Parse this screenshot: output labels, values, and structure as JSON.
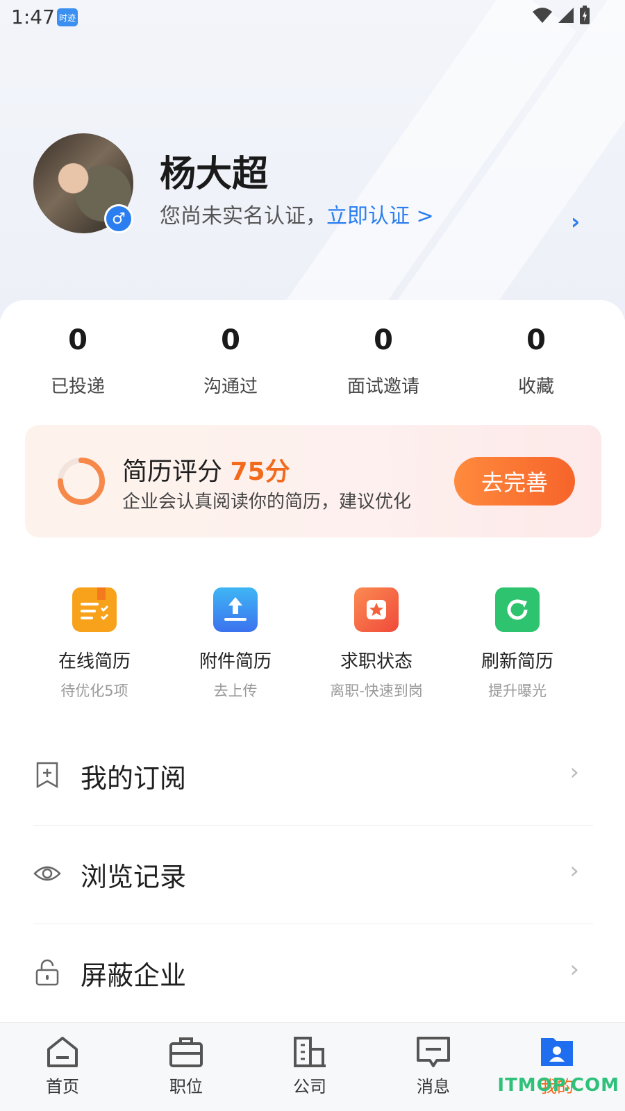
{
  "status_bar": {
    "time": "1:47",
    "app_badge": "时迹"
  },
  "profile": {
    "name": "杨大超",
    "verify_text": "您尚未实名认证，",
    "verify_link": "立即认证 >",
    "gender_symbol": "♂"
  },
  "stats": [
    {
      "value": "0",
      "label": "已投递"
    },
    {
      "value": "0",
      "label": "沟通过"
    },
    {
      "value": "0",
      "label": "面试邀请"
    },
    {
      "value": "0",
      "label": "收藏"
    }
  ],
  "resume": {
    "title": "简历评分",
    "score": "75分",
    "score_percent": 75,
    "subtitle": "企业会认真阅读你的简历，建议优化",
    "button": "去完善"
  },
  "tools": [
    {
      "name": "在线简历",
      "sub": "待优化5项",
      "icon": "document-icon",
      "color": "#f8a21c"
    },
    {
      "name": "附件简历",
      "sub": "去上传",
      "icon": "upload-icon",
      "color": "#3b8ef2"
    },
    {
      "name": "求职状态",
      "sub": "离职-快速到岗",
      "icon": "star-icon",
      "color": "#f4623a"
    },
    {
      "name": "刷新简历",
      "sub": "提升曝光",
      "icon": "refresh-icon",
      "color": "#2ec36e"
    }
  ],
  "menu": [
    {
      "label": "我的订阅",
      "icon": "bookmark-plus-icon"
    },
    {
      "label": "浏览记录",
      "icon": "eye-icon"
    },
    {
      "label": "屏蔽企业",
      "icon": "lock-icon"
    }
  ],
  "tabs": [
    {
      "label": "首页",
      "icon": "home-icon"
    },
    {
      "label": "职位",
      "icon": "briefcase-icon"
    },
    {
      "label": "公司",
      "icon": "building-icon"
    },
    {
      "label": "消息",
      "icon": "message-icon"
    },
    {
      "label": "我的",
      "icon": "profile-icon",
      "active": true
    }
  ],
  "watermark": "ITMOP.COM",
  "colors": {
    "accent": "#2b7ef0",
    "orange": "#f26a1b"
  }
}
